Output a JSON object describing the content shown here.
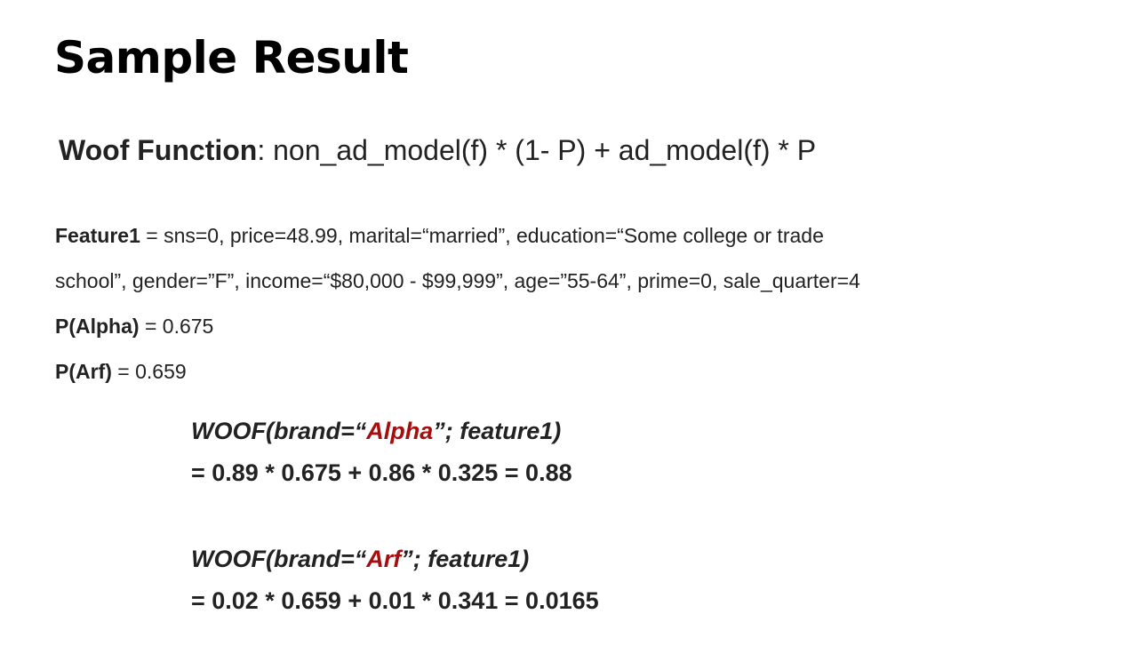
{
  "title": "Sample Result",
  "woof_function": {
    "label": "Woof Function",
    "formula": ": non_ad_model(f) * (1- P) + ad_model(f) * P"
  },
  "feature1": {
    "label": "Feature1",
    "line1": " = sns=0, price=48.99, marital=“married”, education=“Some college or trade",
    "line2": "school”, gender=”F”, income=“$80,000 - $99,999”, age=”55-64”, prime=0, sale_quarter=4"
  },
  "probabilities": [
    {
      "label": "P(Alpha)",
      "value": " = 0.675"
    },
    {
      "label": "P(Arf)",
      "value": " = 0.659"
    }
  ],
  "calculations": [
    {
      "prefix": "WOOF(brand=“",
      "brand": "Alpha",
      "suffix": "”; feature1)",
      "result": "= 0.89 * 0.675 + 0.86 * 0.325 = 0.88"
    },
    {
      "prefix": "WOOF(brand=“",
      "brand": "Arf",
      "suffix": "”; feature1)",
      "result": "= 0.02 * 0.659 + 0.01 * 0.341 = 0.0165"
    }
  ],
  "colors": {
    "brand_highlight": "#a50e0e",
    "text": "#222222",
    "title": "#000000"
  }
}
